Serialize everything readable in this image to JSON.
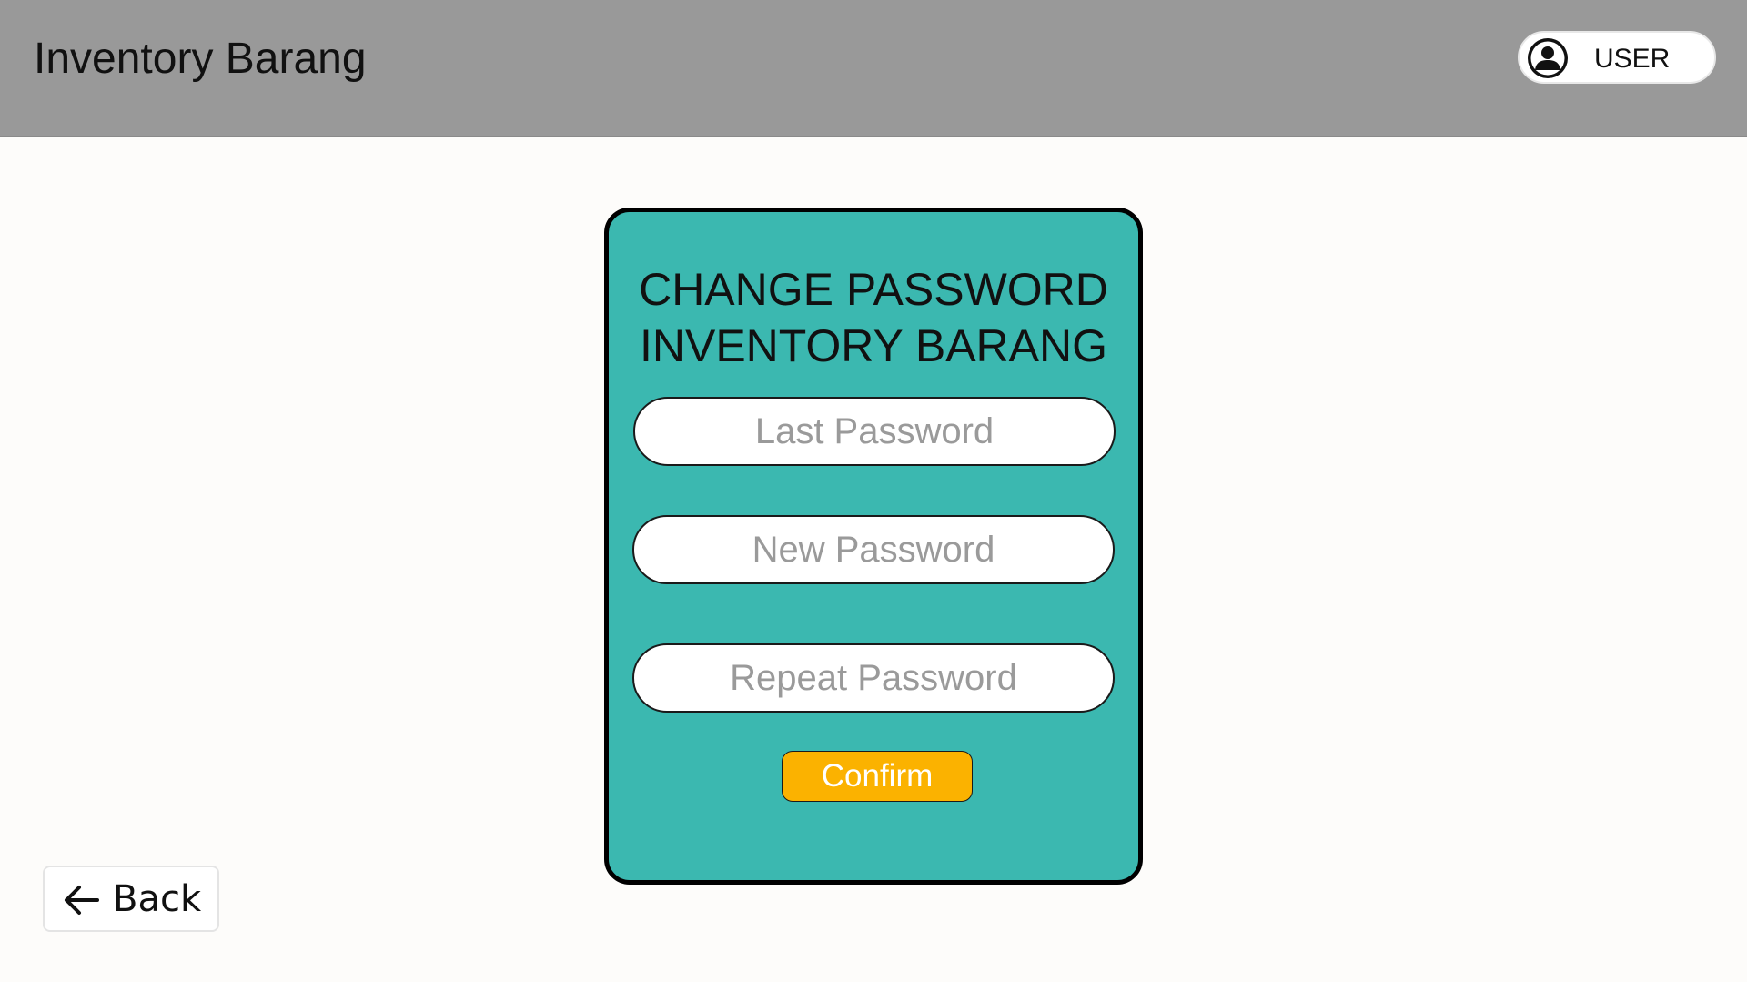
{
  "header": {
    "title": "Inventory Barang",
    "user_label": "USER"
  },
  "form": {
    "title_line1": "CHANGE PASSWORD",
    "title_line2": "INVENTORY BARANG",
    "last_password_placeholder": "Last Password",
    "new_password_placeholder": "New Password",
    "repeat_password_placeholder": "Repeat Password",
    "confirm_label": "Confirm"
  },
  "back": {
    "label": "Back"
  },
  "icons": {
    "user": "user-avatar-icon",
    "back": "arrow-left-icon"
  },
  "colors": {
    "header_bg": "#999999",
    "card_bg": "#3bb8b0",
    "confirm_bg": "#fbb200",
    "page_bg": "#fdfcfa"
  }
}
